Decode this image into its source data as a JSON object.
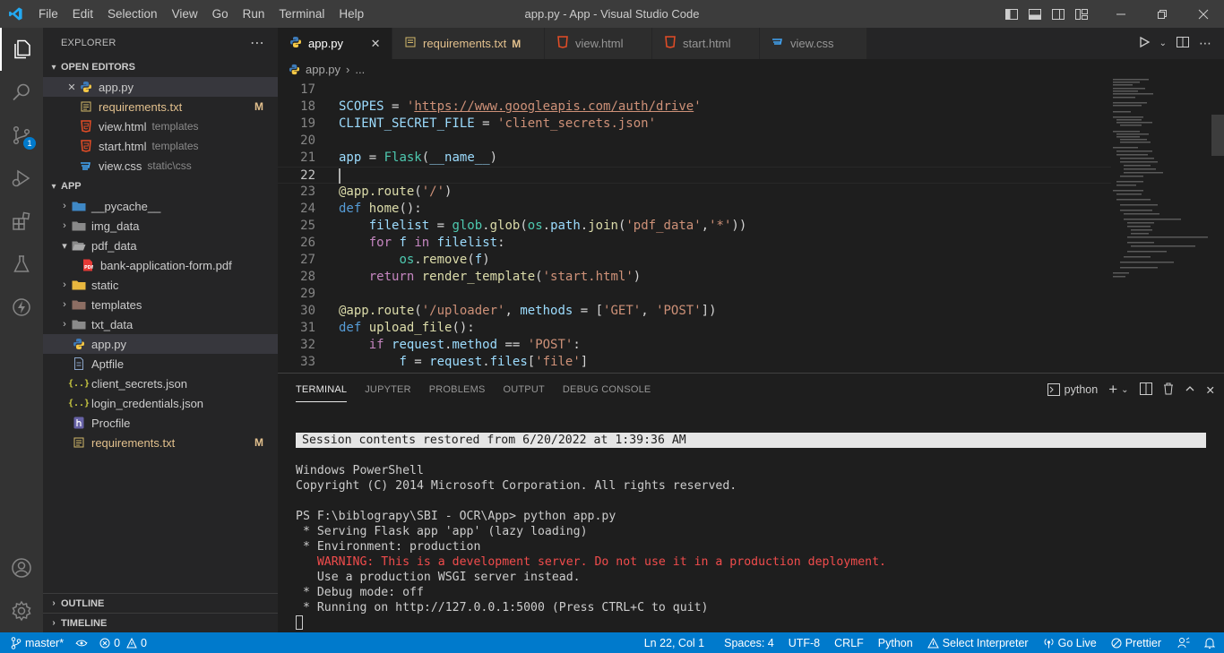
{
  "titlebar": {
    "menu": [
      "File",
      "Edit",
      "Selection",
      "View",
      "Go",
      "Run",
      "Terminal",
      "Help"
    ],
    "title": "app.py - App - Visual Studio Code"
  },
  "activity": {
    "source_control_badge": "1"
  },
  "explorer": {
    "title": "EXPLORER",
    "open_editors_label": "OPEN EDITORS",
    "open_editors": [
      {
        "name": "app.py",
        "desc": "",
        "icon": "python-icon",
        "mod": ""
      },
      {
        "name": "requirements.txt",
        "desc": "",
        "icon": "text-file-icon",
        "mod": "M"
      },
      {
        "name": "view.html",
        "desc": "templates",
        "icon": "html-icon",
        "mod": ""
      },
      {
        "name": "start.html",
        "desc": "templates",
        "icon": "html-icon",
        "mod": ""
      },
      {
        "name": "view.css",
        "desc": "static\\css",
        "icon": "css-icon",
        "mod": ""
      }
    ],
    "folder_label": "APP",
    "tree": [
      {
        "name": "__pycache__",
        "type": "folder"
      },
      {
        "name": "img_data",
        "type": "folder"
      },
      {
        "name": "pdf_data",
        "type": "folder-open"
      },
      {
        "name": "bank-application-form.pdf",
        "type": "pdf"
      },
      {
        "name": "static",
        "type": "folder"
      },
      {
        "name": "templates",
        "type": "folder"
      },
      {
        "name": "txt_data",
        "type": "folder"
      },
      {
        "name": "app.py",
        "type": "python"
      },
      {
        "name": "Aptfile",
        "type": "file"
      },
      {
        "name": "client_secrets.json",
        "type": "json"
      },
      {
        "name": "login_credentials.json",
        "type": "json"
      },
      {
        "name": "Procfile",
        "type": "procfile"
      },
      {
        "name": "requirements.txt",
        "type": "text",
        "mod": "M"
      }
    ],
    "outline_label": "OUTLINE",
    "timeline_label": "TIMELINE"
  },
  "tabs": [
    {
      "label": "app.py",
      "icon": "python-icon",
      "active": true,
      "mod": ""
    },
    {
      "label": "requirements.txt",
      "icon": "text-file-icon",
      "active": false,
      "mod": "M"
    },
    {
      "label": "view.html",
      "icon": "html-icon",
      "active": false,
      "mod": ""
    },
    {
      "label": "start.html",
      "icon": "html-icon",
      "active": false,
      "mod": ""
    },
    {
      "label": "view.css",
      "icon": "css-icon",
      "active": false,
      "mod": ""
    }
  ],
  "breadcrumb": {
    "file": "app.py",
    "more": "..."
  },
  "editor": {
    "line_numbers": [
      "17",
      "18",
      "19",
      "20",
      "21",
      "22",
      "23",
      "24",
      "25",
      "26",
      "27",
      "28",
      "29",
      "30",
      "31",
      "32",
      "33"
    ],
    "current_line": "22"
  },
  "panel": {
    "tabs": [
      "TERMINAL",
      "JUPYTER",
      "PROBLEMS",
      "OUTPUT",
      "DEBUG CONSOLE"
    ],
    "shell": "python",
    "terminal_lines": [
      "",
      "Session contents restored from 6/20/2022 at 1:39:36 AM",
      "",
      "Windows PowerShell",
      "Copyright (C) 2014 Microsoft Corporation. All rights reserved.",
      "",
      "PS F:\\biblograpy\\SBI - OCR\\App> python app.py",
      " * Serving Flask app 'app' (lazy loading)",
      " * Environment: production",
      "   WARNING: This is a development server. Do not use it in a production deployment.",
      "   Use a production WSGI server instead.",
      " * Debug mode: off",
      " * Running on http://127.0.0.1:5000 (Press CTRL+C to quit)"
    ]
  },
  "statusbar": {
    "branch": "master*",
    "errors": "0",
    "warnings": "0",
    "position": "Ln 22, Col 1",
    "spaces": "Spaces: 4",
    "encoding": "UTF-8",
    "eol": "CRLF",
    "language": "Python",
    "interpreter": "Select Interpreter",
    "golive": "Go Live",
    "prettier": "Prettier"
  },
  "colors": {
    "accent": "#007acc",
    "modified": "#e2c08d",
    "warning_text": "#f14c4c"
  }
}
